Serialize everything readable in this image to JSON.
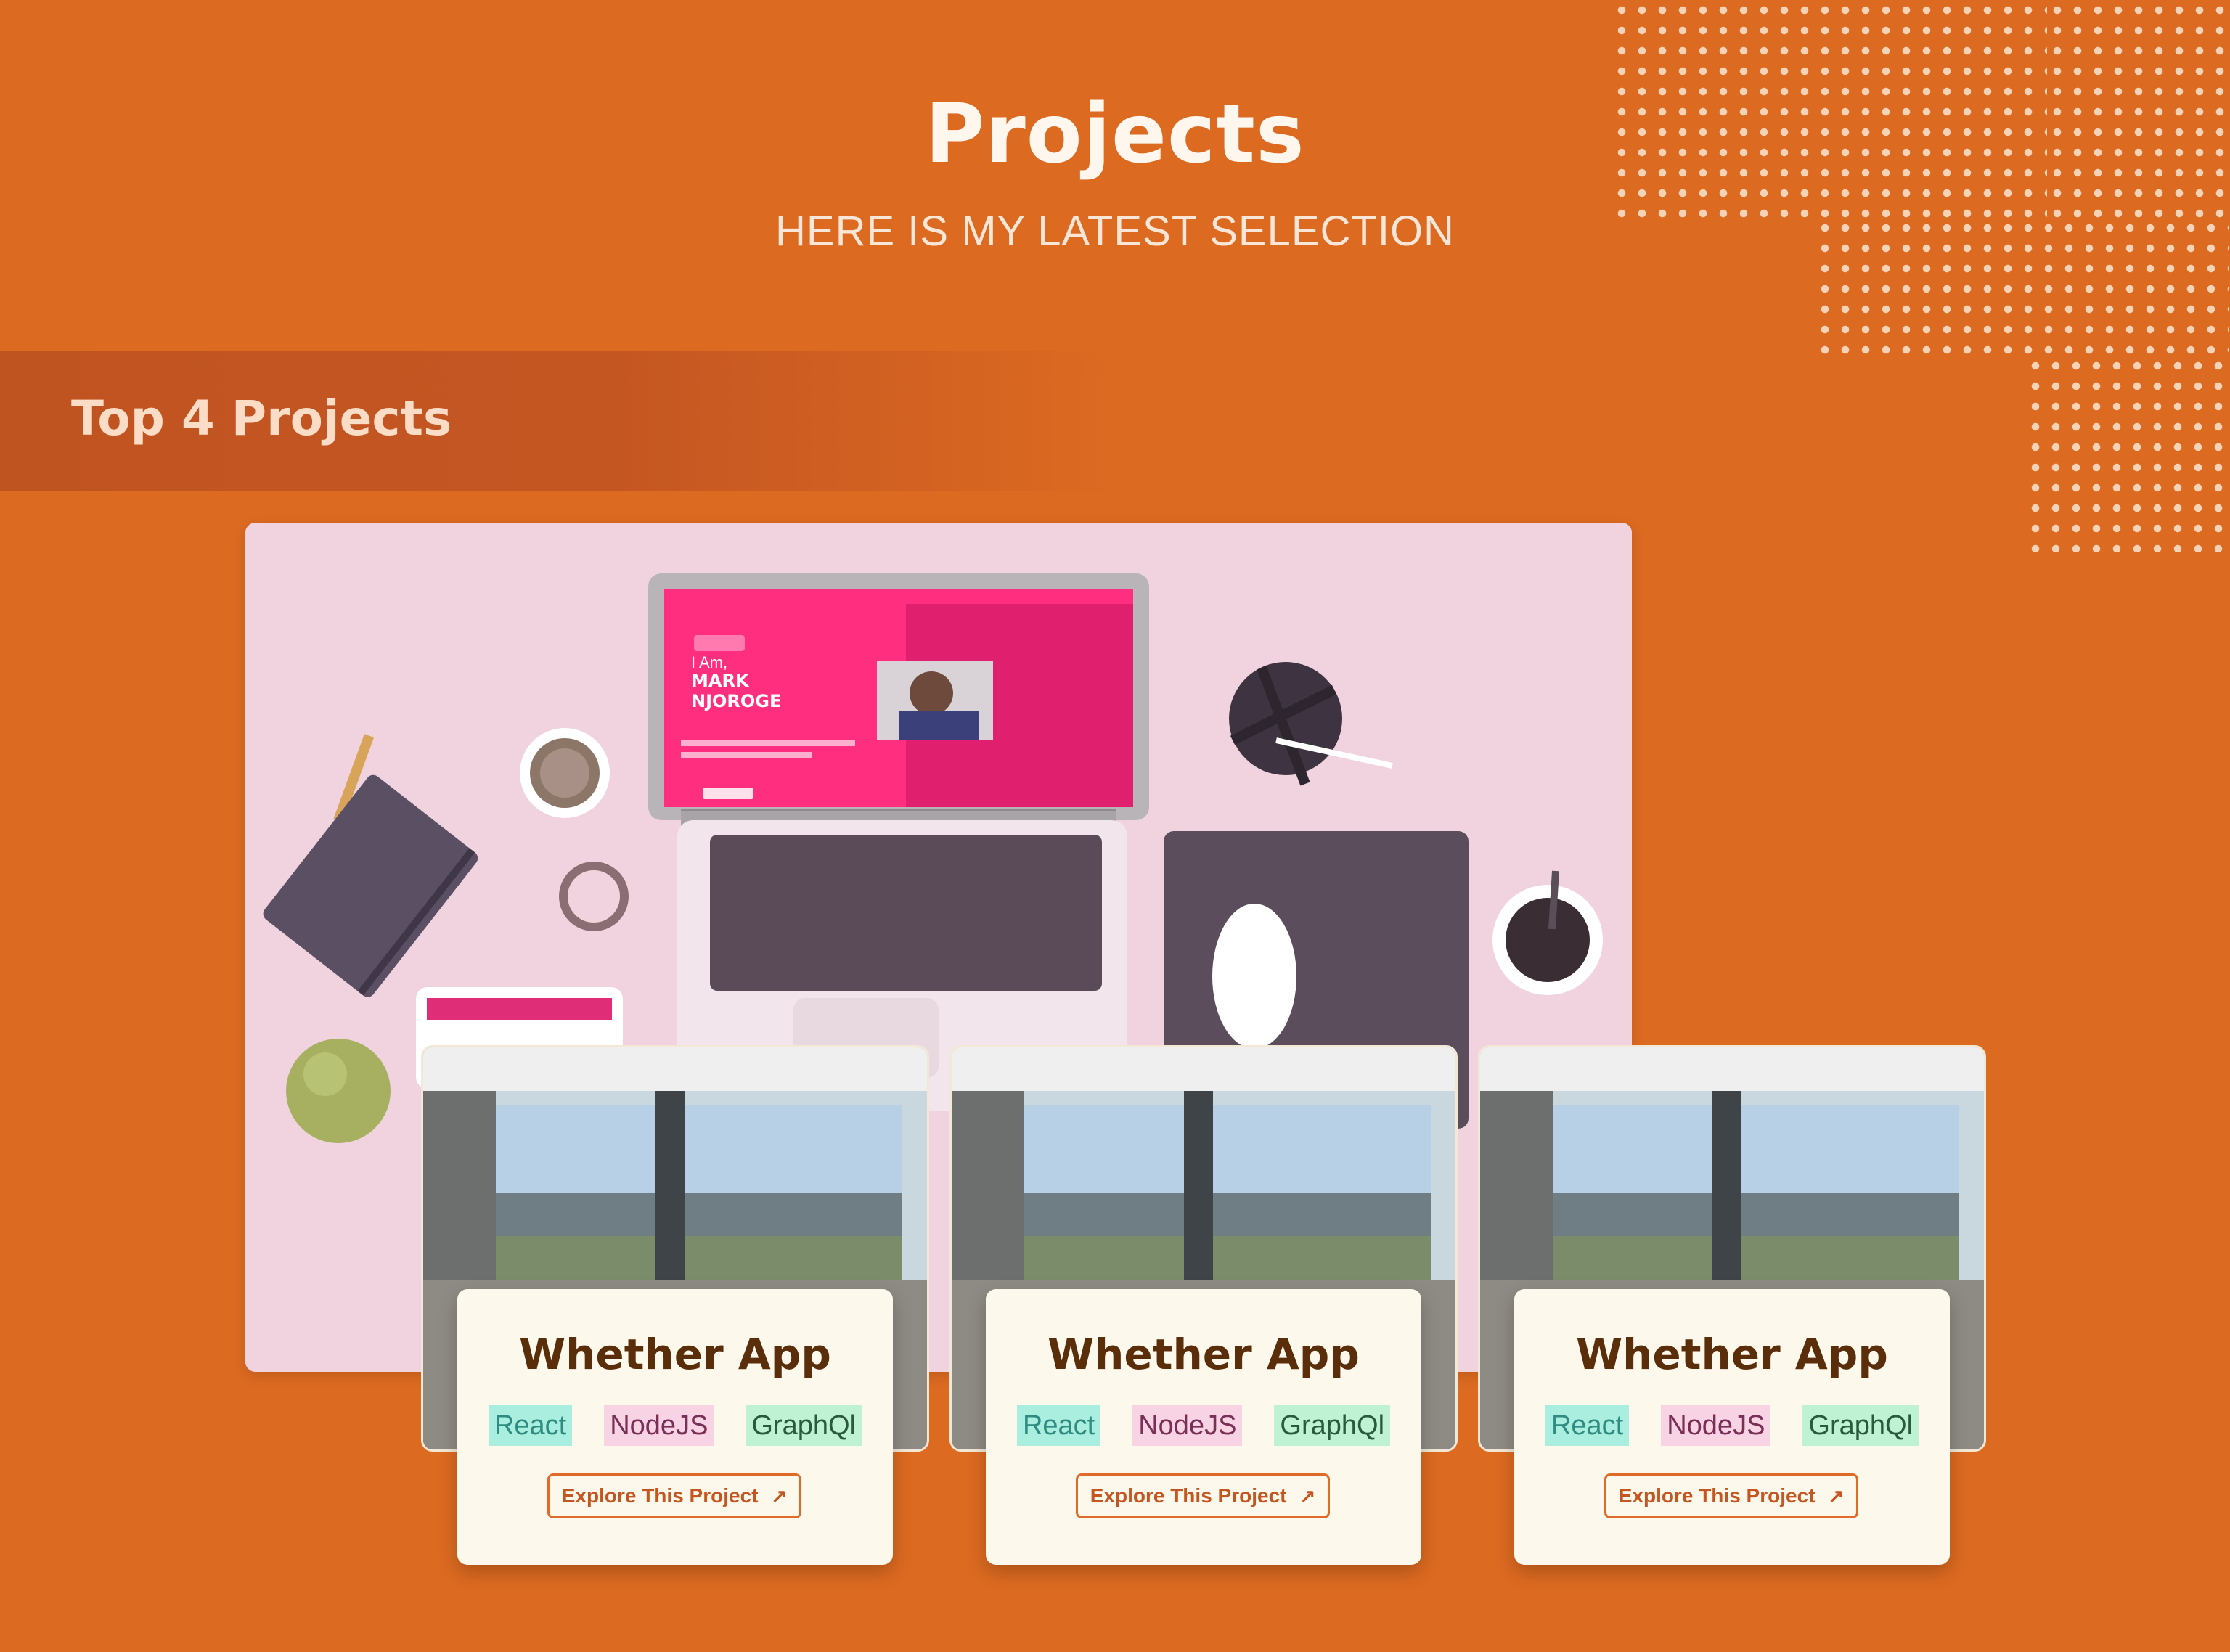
{
  "header": {
    "title": "Projects",
    "subtitle": "HERE IS MY LATEST SELECTION"
  },
  "section": {
    "label": "Top 4 Projects"
  },
  "hero": {
    "screen_greeting": "I Am,",
    "screen_name_line1": "MARK",
    "screen_name_line2": "NJOROGE"
  },
  "cards": [
    {
      "title": "Whether App",
      "tags": [
        "React",
        "NodeJS",
        "GraphQl"
      ],
      "cta": "Explore This Project"
    },
    {
      "title": "Whether App",
      "tags": [
        "React",
        "NodeJS",
        "GraphQl"
      ],
      "cta": "Explore This Project"
    },
    {
      "title": "Whether App",
      "tags": [
        "React",
        "NodeJS",
        "GraphQl"
      ],
      "cta": "Explore This Project"
    }
  ],
  "colors": {
    "background": "#DC6A21",
    "band": "#C05420",
    "card_panel": "#FDF8EC",
    "title_brown": "#5A2E0B"
  },
  "icons": {
    "cta_icon": "arrow-up-right-icon"
  }
}
